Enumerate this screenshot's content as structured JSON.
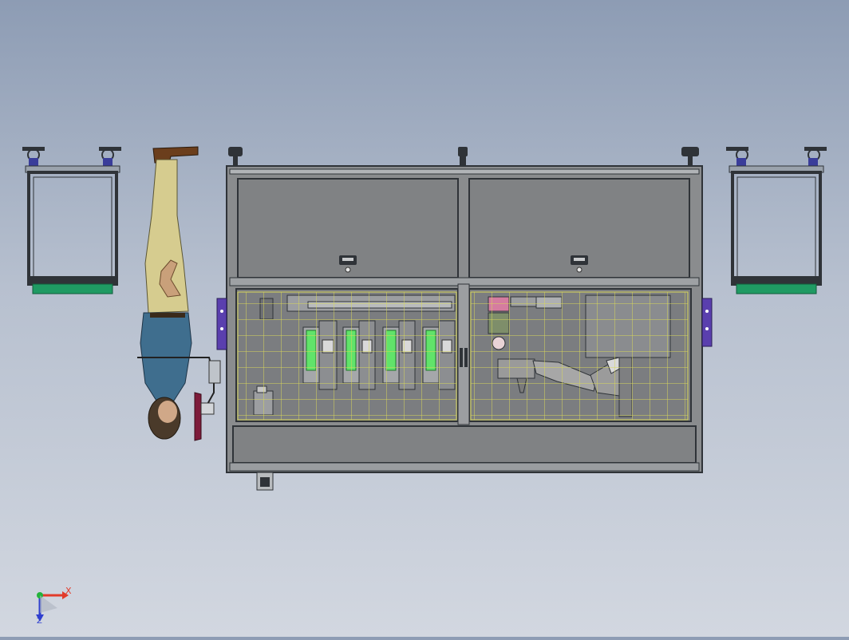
{
  "view": {
    "type": "cad-assembly-top-view",
    "background_gradient": [
      "#8d9cb4",
      "#d2d7e0"
    ]
  },
  "colors": {
    "frame": "#2f3338",
    "panel": "#808284",
    "panel_dark": "#6f7173",
    "grid": "#d8d85a",
    "green": "#1f9a63",
    "bright_green": "#61e36a",
    "purple": "#5a3fae",
    "maroon": "#7d1b3a",
    "person_pants": "#d6cc8f",
    "person_shirt": "#3f6e8e",
    "robot_arm": "#9a9a9a"
  },
  "triad": {
    "x_label": "X",
    "z_label": "Z",
    "x_color": "#e23b2a",
    "y_color": "#23b33b",
    "z_color": "#2f3fcf"
  }
}
